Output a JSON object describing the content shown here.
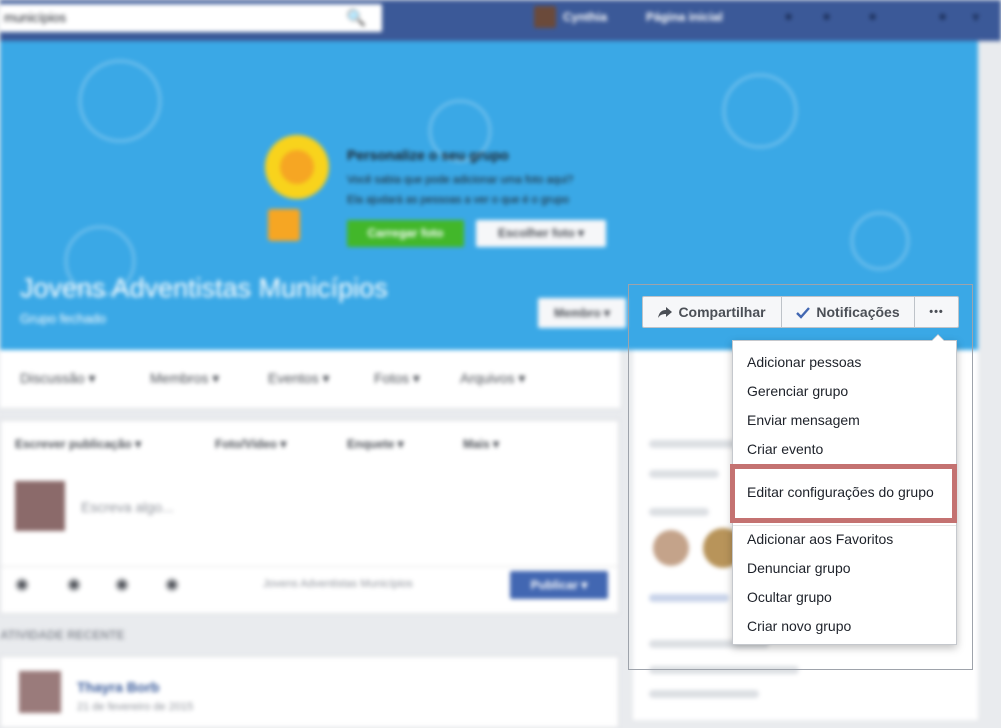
{
  "topbar": {
    "search_value": "municípios",
    "user_name": "Cynthia",
    "home_label": "Página inicial"
  },
  "cover": {
    "promo_title": "Personalize o seu grupo",
    "promo_line1": "Você sabia que pode adicionar uma foto aqui?",
    "promo_line2": "Ela ajudará as pessoas a ver o que é o grupo",
    "upload_label": "Carregar foto",
    "choose_label": "Escolher foto ▾",
    "group_name": "Jovens Adventistas Municípios",
    "group_type": "Grupo fechado",
    "joined_label": "Membro ▾",
    "colors": {
      "cover_blue": "#3aa8e6",
      "topbar_blue": "#3b5998"
    }
  },
  "tabs": {
    "discussion": "Discussão ▾",
    "members": "Membros ▾",
    "events": "Eventos ▾",
    "photos": "Fotos ▾",
    "files": "Arquivos ▾"
  },
  "composer": {
    "tab_post": "Escrever publicação ▾",
    "tab_photo": "Foto/Vídeo ▾",
    "tab_poll": "Enquete ▾",
    "tab_more": "Mais ▾",
    "placeholder": "Escreva algo...",
    "group_target": "Jovens Adventistas Municípios",
    "publish_label": "Publicar ▾"
  },
  "feed": {
    "recent_header": "ATIVIDADE RECENTE",
    "post_author": "Thayra Borb",
    "post_date": "21 de fevereiro de 2015"
  },
  "actionbar": {
    "share_label": "Compartilhar",
    "notifications_label": "Notificações",
    "more_label": "•••"
  },
  "menu": {
    "items": [
      "Adicionar pessoas",
      "Gerenciar grupo",
      "Enviar mensagem",
      "Criar evento",
      "Editar configurações do grupo",
      "Adicionar aos Favoritos",
      "Denunciar grupo",
      "Ocultar grupo",
      "Criar novo grupo"
    ],
    "highlight_color": "#c47271"
  }
}
